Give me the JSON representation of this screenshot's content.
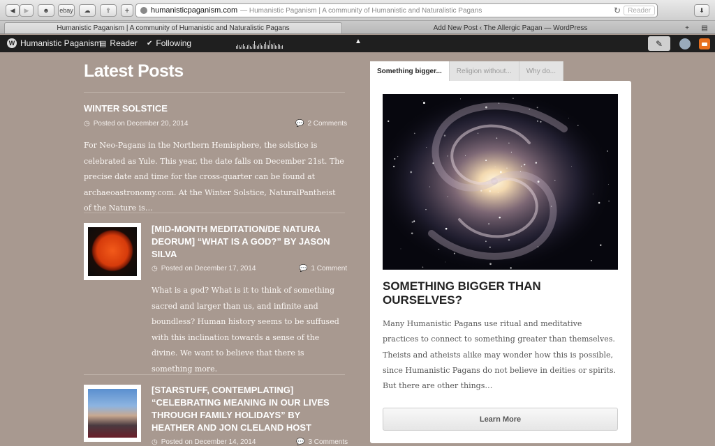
{
  "browser": {
    "url_domain": "humanisticpaganism.com",
    "url_title": "— Humanistic Paganism | A community of Humanistic and Naturalistic Pagans",
    "reader_label": "Reader",
    "ebay_label": "ebay",
    "tabs": [
      {
        "label": "Humanistic Paganism | A community of Humanistic and Naturalistic Pagans"
      },
      {
        "label": "Add New Post ‹ The Allergic Pagan — WordPress"
      }
    ]
  },
  "adminbar": {
    "site_name": "Humanistic Paganism",
    "reader": "Reader",
    "following": "Following",
    "stats_bars": [
      0.3,
      0.5,
      0.4,
      0.2,
      0.4,
      0.6,
      0.3,
      0.2,
      0.4,
      0.5,
      0.3,
      0.2,
      0.6,
      0.9,
      0.4,
      0.3,
      0.5,
      0.7,
      0.4,
      0.3,
      0.6,
      0.8,
      0.5,
      0.4,
      1.0,
      0.6,
      0.5,
      0.7,
      0.4,
      0.3,
      0.6,
      0.5,
      0.3,
      0.4
    ]
  },
  "main": {
    "heading": "Latest Posts",
    "posts": [
      {
        "title": "Winter Solstice",
        "date": "Posted on December 20, 2014",
        "comments": "2 Comments",
        "excerpt": "For Neo-Pagans in the Northern Hemisphere, the solstice is celebrated as Yule. This year, the date falls on December 21st. The precise date and time for the cross-quarter can be found at archaeoastronomy.com. At the Winter Solstice, NaturalPantheist of the Nature is…"
      },
      {
        "title": "[Mid-Month Meditation/De Natura Deorum] “What is a God?” by Jason Silva",
        "date": "Posted on December 17, 2014",
        "comments": "1 Comment",
        "excerpt": "What is a god? What is it to think of something sacred and larger than us, and infinite and boundless? Human history seems to be suffused with this inclination towards a sense of the divine. We want to believe that there is something more."
      },
      {
        "title": "[Starstuff, Contemplating] “Celebrating Meaning in Our Lives Through Family Holidays” by Heather and Jon Cleland Host",
        "date": "Posted on December 14, 2014",
        "comments": "3 Comments"
      }
    ]
  },
  "widget": {
    "tabs": [
      "Something bigger...",
      "Religion without...",
      "Why do..."
    ],
    "title": "Something bigger than ourselves?",
    "text": "Many Humanistic Pagans use ritual and meditative practices to connect to something greater than themselves. Theists and atheists alike may wonder how this is possible, since Humanistic Pagans do not believe in deities or spirits. But there are other things…",
    "button": "Learn More"
  }
}
